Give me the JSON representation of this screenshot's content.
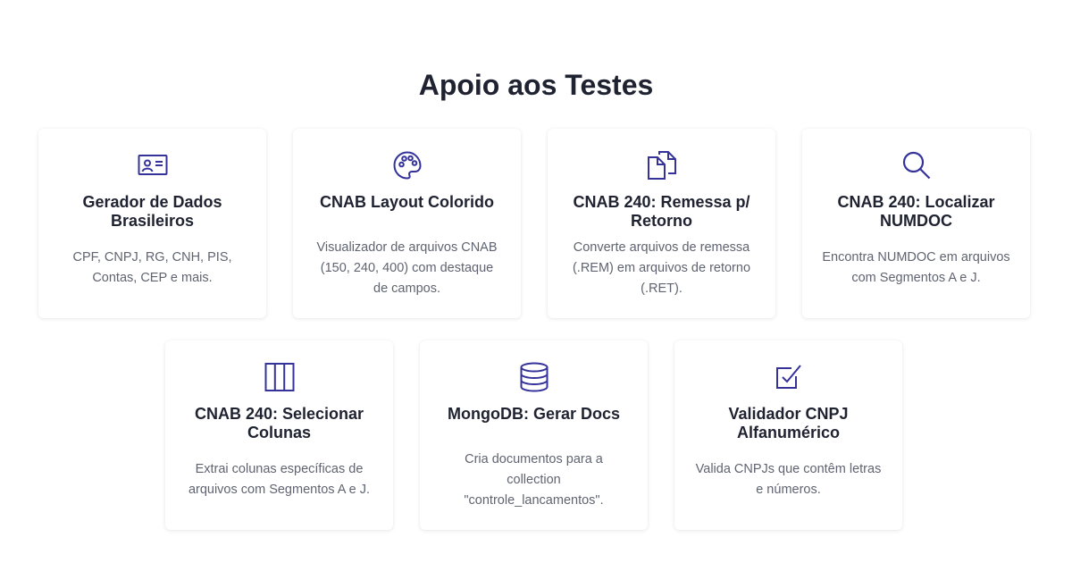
{
  "section": {
    "title": "Apoio aos Testes"
  },
  "cards": [
    {
      "title": "Gerador de Dados Brasileiros",
      "description": "CPF, CNPJ, RG, CNH, PIS, Contas, CEP e mais.",
      "icon": "id-card-icon"
    },
    {
      "title": "CNAB Layout Colorido",
      "description": "Visualizador de arquivos CNAB (150, 240, 400) com destaque de campos.",
      "icon": "palette-icon"
    },
    {
      "title": "CNAB 240: Remessa p/ Retorno",
      "description": "Converte arquivos de remessa (.REM) em arquivos de retorno (.RET).",
      "icon": "files-icon"
    },
    {
      "title": "CNAB 240: Localizar NUMDOC",
      "description": "Encontra NUMDOC em arquivos com Segmentos A e J.",
      "icon": "search-icon"
    },
    {
      "title": "CNAB 240: Selecionar Colunas",
      "description": "Extrai colunas específicas de arquivos com Segmentos A e J.",
      "icon": "columns-icon"
    },
    {
      "title": "MongoDB: Gerar Docs",
      "description": "Cria documentos para a collection \"controle_lancamentos\".",
      "icon": "database-icon"
    },
    {
      "title": "Validador CNPJ Alfanumérico",
      "description": "Valida CNPJs que contêm letras e números.",
      "icon": "check-square-icon"
    }
  ],
  "colors": {
    "accent": "#35339a",
    "title": "#1f2230",
    "text": "#5f6470"
  }
}
